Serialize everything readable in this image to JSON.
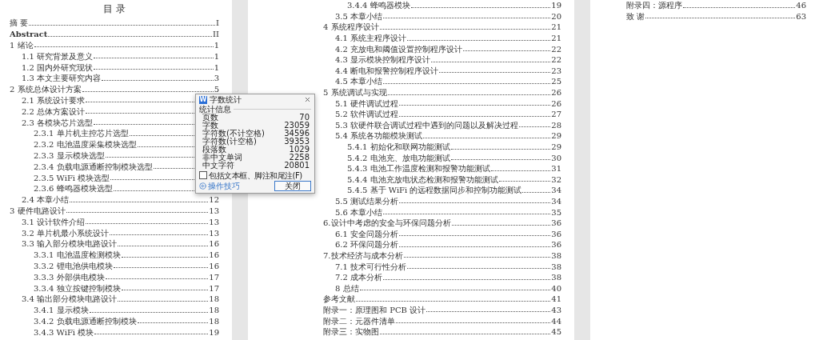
{
  "pages": [
    {
      "title": "目 录",
      "entries": [
        {
          "label": "摘 要",
          "page": "I"
        },
        {
          "label": "Abstract",
          "page": "II",
          "bold": true
        },
        {
          "label": "1 绪论",
          "page": "1",
          "children": [
            {
              "label": "1.1 研究背景及意义",
              "page": "1"
            },
            {
              "label": "1.2 国内外研究现状",
              "page": "1"
            },
            {
              "label": "1.3 本文主要研究内容",
              "page": "3"
            }
          ]
        },
        {
          "label": "2 系统总体设计方案",
          "page": "5",
          "children": [
            {
              "label": "2.1 系统设计要求"
            },
            {
              "label": "2.2 总体方案设计"
            },
            {
              "label": "2.3 各模块芯片选型",
              "children": [
                {
                  "label": "2.3.1 单片机主控芯片选型"
                },
                {
                  "label": "2.3.2 电池温度采集模块选型"
                },
                {
                  "label": "2.3.3 显示模块选型"
                },
                {
                  "label": "2.3.4 负载电源通断控制模块选型"
                },
                {
                  "label": "2.3.5 WiFi 模块选型"
                },
                {
                  "label": "2.3.6 蜂鸣器模块选型"
                }
              ]
            },
            {
              "label": "2.4 本章小结",
              "page": "12"
            }
          ]
        },
        {
          "label": "3 硬件电路设计",
          "page": "13",
          "children": [
            {
              "label": "3.1 设计软件介绍",
              "page": "13"
            },
            {
              "label": "3.2 单片机最小系统设计",
              "page": "13"
            },
            {
              "label": "3.3 输入部分模块电路设计",
              "page": "16",
              "children": [
                {
                  "label": "3.3.1 电池温度检测模块",
                  "page": "16"
                },
                {
                  "label": "3.3.2 锂电池供电模块",
                  "page": "16"
                },
                {
                  "label": "3.3.3 外部供电模块",
                  "page": "17"
                },
                {
                  "label": "3.3.4 独立按键控制模块",
                  "page": "17"
                }
              ]
            },
            {
              "label": "3.4 输出部分模块电路设计",
              "page": "18",
              "children": [
                {
                  "label": "3.4.1 显示模块",
                  "page": "18"
                },
                {
                  "label": "3.4.2 负载电源通断控制模块",
                  "page": "18"
                },
                {
                  "label": "3.4.3 WiFi 模块",
                  "page": "19"
                }
              ]
            }
          ]
        }
      ]
    },
    {
      "entries": [
        {
          "children": [
            {
              "children": [
                {
                  "label": "3.4.4 蜂鸣器模块",
                  "page": "19"
                }
              ]
            },
            {
              "label": "3.5 本章小结",
              "page": "20"
            }
          ]
        },
        {
          "label": "4 系统程序设计",
          "page": "21",
          "children": [
            {
              "label": "4.1 系统主程序设计",
              "page": "21"
            },
            {
              "label": "4.2 充放电和阈值设置控制程序设计",
              "page": "22"
            },
            {
              "label": "4.3 显示模块控制程序设计",
              "page": "22"
            },
            {
              "label": "4.4 断电和报警控制程序设计",
              "page": "23"
            },
            {
              "label": "4.5 本章小结",
              "page": "25"
            }
          ]
        },
        {
          "label": "5 系统调试与实现",
          "page": "26",
          "children": [
            {
              "label": "5.1 硬件调试过程",
              "page": "26"
            },
            {
              "label": "5.2 软件调试过程",
              "page": "27"
            },
            {
              "label": "5.3 软硬件联合调试过程中遇到的问题以及解决过程",
              "page": "28"
            },
            {
              "label": "5.4 系统各功能模块测试",
              "page": "29",
              "children": [
                {
                  "label": "5.4.1 初始化和联网功能测试",
                  "page": "29"
                },
                {
                  "label": "5.4.2 电池充、放电功能测试",
                  "page": "30"
                },
                {
                  "label": "5.4.3 电池工作温度检测和报警功能测试",
                  "page": "31"
                },
                {
                  "label": "5.4.4 电池充放电状态检测和报警功能测试",
                  "page": "32"
                },
                {
                  "label": "5.4.5 基于 WiFi 的远程数据同步和控制功能测试",
                  "page": "34"
                }
              ]
            },
            {
              "label": "5.5 测试结果分析",
              "page": "34"
            },
            {
              "label": "5.6 本章小结",
              "page": "35"
            }
          ]
        },
        {
          "label": "6.设计中考虑的安全与环保问题分析",
          "page": "36",
          "children": [
            {
              "label": "6.1 安全问题分析",
              "page": "36"
            },
            {
              "label": "6.2 环保问题分析",
              "page": "36"
            }
          ]
        },
        {
          "label": "7.技术经济与成本分析",
          "page": "38",
          "children": [
            {
              "label": "7.1 技术可行性分析",
              "page": "38"
            },
            {
              "label": "7.2 成本分析",
              "page": "38"
            },
            {
              "label": "8 总结",
              "page": "40"
            }
          ]
        },
        {
          "label": "参考文献",
          "page": "41"
        },
        {
          "label": "附录一：原理图和 PCB 设计",
          "page": "43"
        },
        {
          "label": "附录二：元器件清单",
          "page": "44"
        },
        {
          "label": "附录三：实物图",
          "page": "45"
        }
      ]
    },
    {
      "entries": [
        {
          "label": "附录四：源程序",
          "page": "46"
        },
        {
          "label": "致 谢",
          "page": "63"
        }
      ]
    }
  ],
  "dialog": {
    "icon_letter": "W",
    "title": "字数统计",
    "section": "统计信息",
    "stats": [
      {
        "label": "页数",
        "value": "70"
      },
      {
        "label": "字数",
        "value": "23059"
      },
      {
        "label": "字符数(不计空格)",
        "value": "34596"
      },
      {
        "label": "字符数(计空格)",
        "value": "39353"
      },
      {
        "label": "段落数",
        "value": "1029"
      },
      {
        "label": "非中文单词",
        "value": "2258"
      },
      {
        "label": "中文字符",
        "value": "20801"
      }
    ],
    "checkbox": {
      "label": "包括文本框、脚注和尾注(F)",
      "checked": false
    },
    "help_link": "操作技巧",
    "button": "关闭"
  }
}
